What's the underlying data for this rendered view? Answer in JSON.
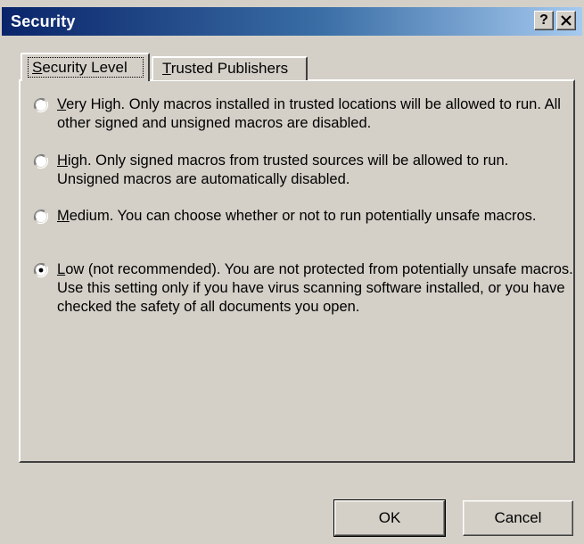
{
  "window": {
    "title": "Security"
  },
  "titlebar": {
    "help_label": "?"
  },
  "tabs": [
    {
      "label": "Security Level",
      "mnemonic": "S",
      "rest": "ecurity Level",
      "selected": true
    },
    {
      "label": "Trusted Publishers",
      "mnemonic": "T",
      "rest": "rusted Publishers",
      "selected": false
    }
  ],
  "options": [
    {
      "mnemonic": "V",
      "rest": "ery High. Only macros installed in trusted locations will be allowed to run. All other signed and unsigned macros are disabled.",
      "label": "Very High. Only macros installed in trusted locations will be allowed to run. All other signed and unsigned macros are disabled.",
      "checked": false
    },
    {
      "mnemonic": "H",
      "rest": "igh. Only signed macros from trusted sources will be allowed to run. Unsigned macros are automatically disabled.",
      "label": "High. Only signed macros from trusted sources will be allowed to run. Unsigned macros are automatically disabled.",
      "checked": false
    },
    {
      "mnemonic": "M",
      "rest": "edium. You can choose whether or not to run potentially unsafe macros.",
      "label": "Medium. You can choose whether or not to run potentially unsafe macros.",
      "checked": false
    },
    {
      "mnemonic": "L",
      "rest": "ow (not recommended). You are not protected from potentially unsafe macros. Use this setting only if you have virus scanning software installed, or you have checked the safety of all documents you open.",
      "label": "Low (not recommended). You are not protected from potentially unsafe macros. Use this setting only if you have virus scanning software installed, or you have checked the safety of all documents you open.",
      "checked": true
    }
  ],
  "buttons": {
    "ok_label": "OK",
    "cancel_label": "Cancel"
  },
  "colors": {
    "dialog_bg": "#d4d0c8",
    "title_start": "#0a246a",
    "title_end": "#a6caf0"
  }
}
